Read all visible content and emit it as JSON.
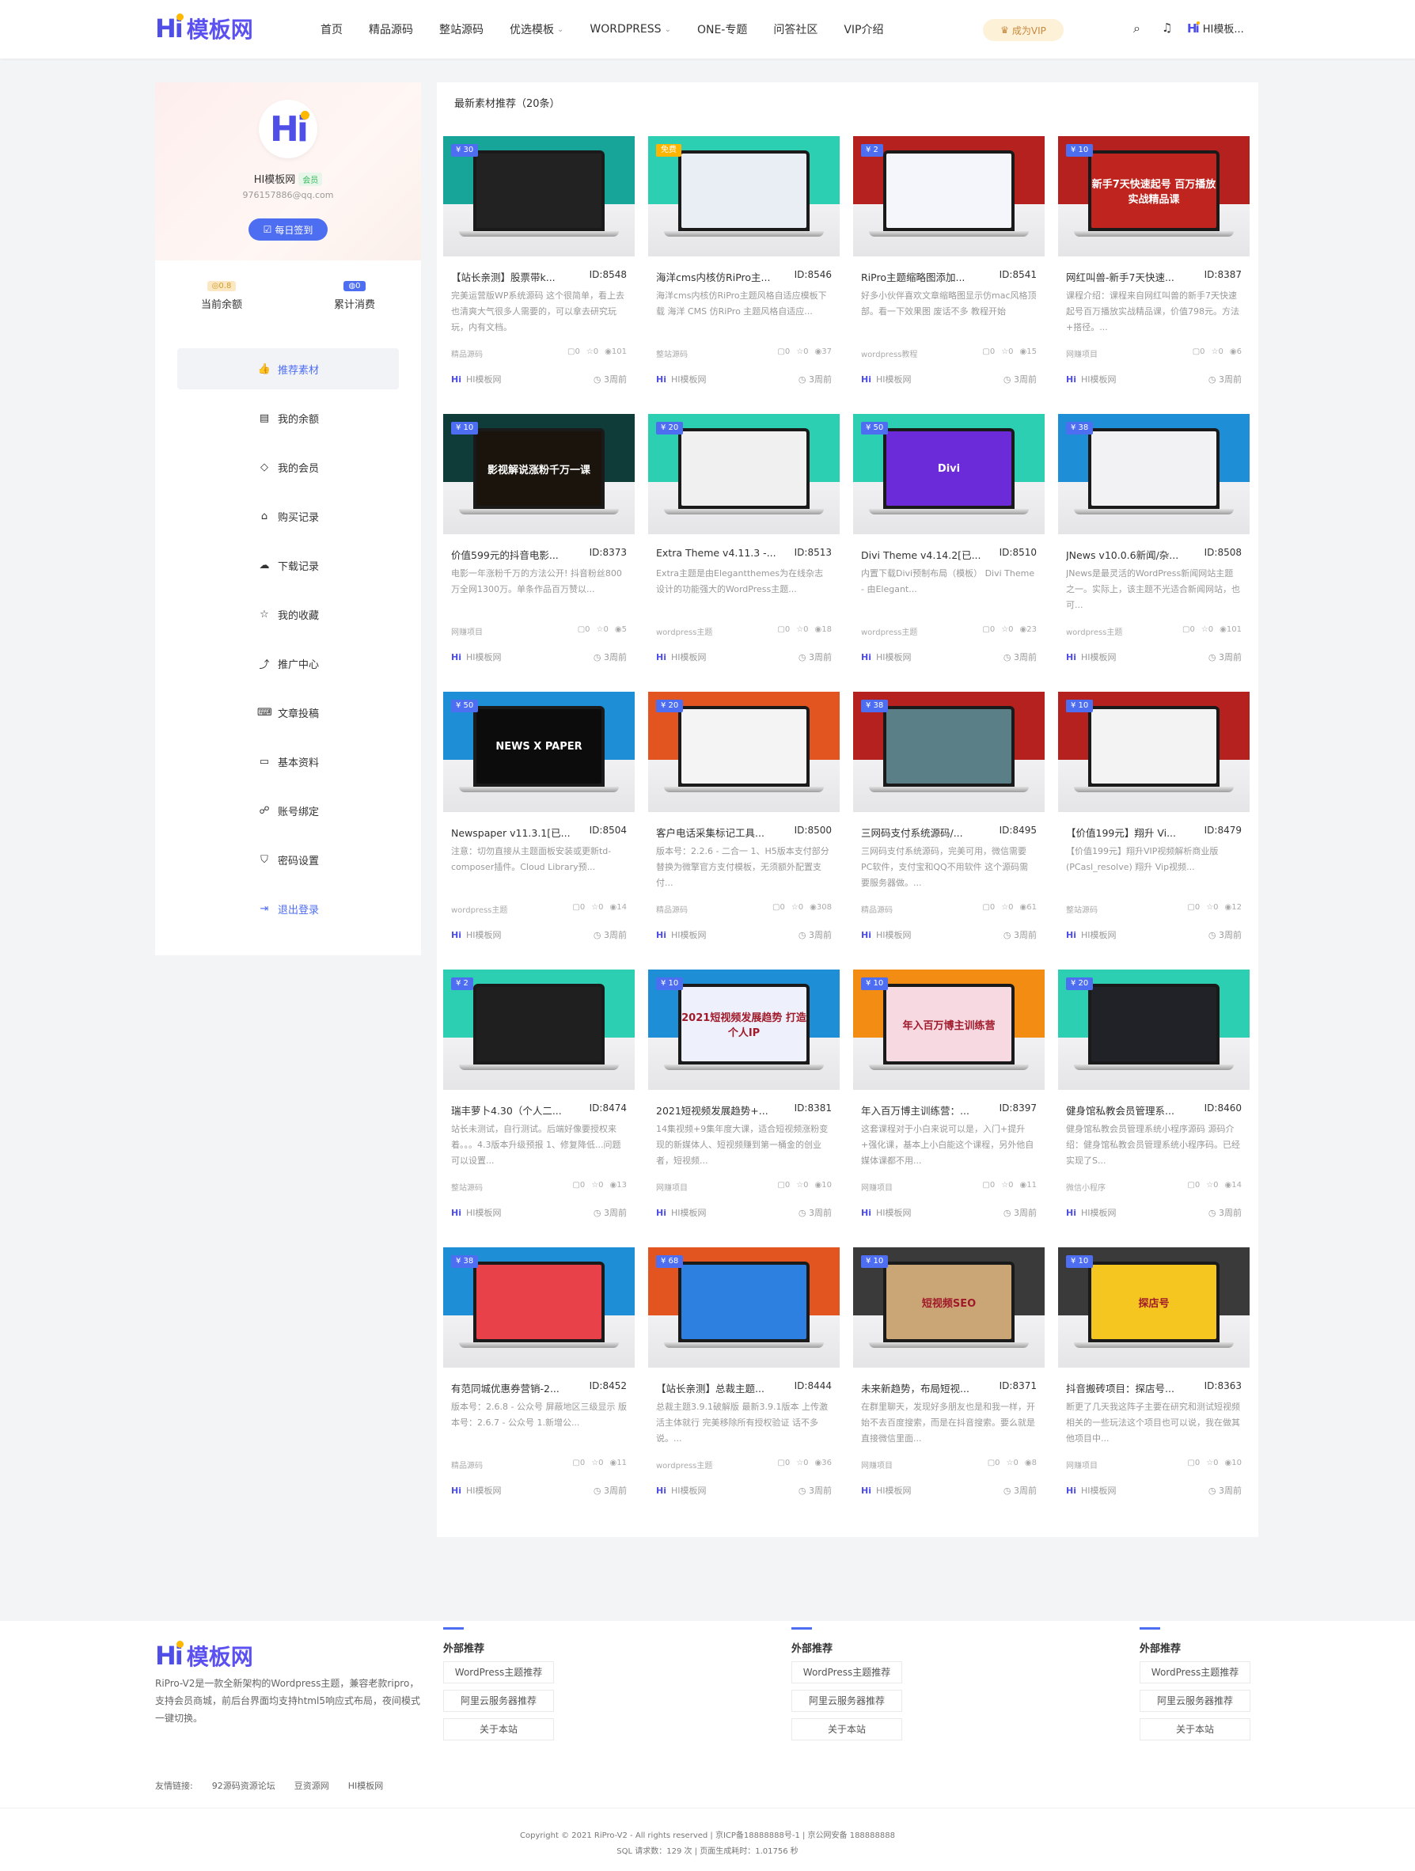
{
  "brand": {
    "hi": "Hi",
    "name": "模板网"
  },
  "nav": [
    {
      "label": "首页",
      "caret": false
    },
    {
      "label": "精品源码",
      "caret": false
    },
    {
      "label": "整站源码",
      "caret": false
    },
    {
      "label": "优选模板",
      "caret": true
    },
    {
      "label": "WORDPRESS",
      "caret": true
    },
    {
      "label": "ONE-专题",
      "caret": false
    },
    {
      "label": "问答社区",
      "caret": false
    },
    {
      "label": "VIP介绍",
      "caret": false
    }
  ],
  "header": {
    "vip_label": "成为VIP",
    "user_label": "HI模板..."
  },
  "sidebar": {
    "username": "HI模板网",
    "member_tag": "会员",
    "email": "976157886@qq.com",
    "sign_label": "每日签到",
    "balance_badge": "0.8",
    "balance_label": "当前余额",
    "spent_badge": "0",
    "spent_label": "累计消费",
    "menu": [
      {
        "label": "推荐素材",
        "icon": "thumbs-up-icon",
        "glyph": "👍",
        "active": true
      },
      {
        "label": "我的余额",
        "icon": "wallet-icon",
        "glyph": "▤"
      },
      {
        "label": "我的会员",
        "icon": "diamond-icon",
        "glyph": "◇"
      },
      {
        "label": "购买记录",
        "icon": "basket-icon",
        "glyph": "⌂"
      },
      {
        "label": "下载记录",
        "icon": "cloud-download-icon",
        "glyph": "☁"
      },
      {
        "label": "我的收藏",
        "icon": "star-icon",
        "glyph": "☆"
      },
      {
        "label": "推广中心",
        "icon": "share-icon",
        "glyph": "⤴"
      },
      {
        "label": "文章投稿",
        "icon": "keyboard-icon",
        "glyph": "⌨"
      },
      {
        "label": "基本资料",
        "icon": "id-card-icon",
        "glyph": "▭"
      },
      {
        "label": "账号绑定",
        "icon": "users-icon",
        "glyph": "☍"
      },
      {
        "label": "密码设置",
        "icon": "shield-icon",
        "glyph": "⛉"
      },
      {
        "label": "退出登录",
        "icon": "logout-icon",
        "glyph": "⇥",
        "logout": true
      }
    ]
  },
  "main": {
    "title": "最新素材推荐（20条）"
  },
  "cards": [
    {
      "price": "¥ 30",
      "title": "【站长亲测】股票带k...",
      "id": "ID:8548",
      "desc": "完美运营版WP系统源码 这个很简单，看上去也清爽大气很多人需要的，可以拿去研究玩玩，内有文档。",
      "cat": "精品源码",
      "comments": "0",
      "likes": "0",
      "views": "101",
      "author": "HI模板网",
      "time": "3周前",
      "band": "#17a59a",
      "screen": "#222",
      "screen_text": ""
    },
    {
      "price": "免费",
      "hot": true,
      "title": "海洋cms内核仿RiPro主...",
      "id": "ID:8546",
      "desc": "海洋cms内核仿RiPro主题风格自适应模板下载 海洋 CMS 仿RiPro 主题风格自适应...",
      "cat": "整站源码",
      "comments": "0",
      "likes": "0",
      "views": "37",
      "author": "HI模板网",
      "time": "3周前",
      "band": "#2dcfb3",
      "screen": "#e9eef5",
      "screen_text": ""
    },
    {
      "price": "¥ 2",
      "title": "RiPro主题缩略图添加...",
      "id": "ID:8541",
      "desc": "好多小伙伴喜欢文章缩略图显示仿mac风格顶部。看一下效果图 废话不多 教程开始",
      "cat": "wordpress教程",
      "comments": "0",
      "likes": "0",
      "views": "15",
      "author": "HI模板网",
      "time": "3周前",
      "band": "#b5211f",
      "screen": "#f4f6fb",
      "screen_text": ""
    },
    {
      "price": "¥ 10",
      "title": "网红叫兽-新手7天快速...",
      "id": "ID:8387",
      "desc": "课程介绍：课程来自网红叫兽的新手7天快速起号百万播放实战精品课，价值798元。方法+搭径。...",
      "cat": "网赚项目",
      "comments": "0",
      "likes": "0",
      "views": "6",
      "author": "HI模板网",
      "time": "3周前",
      "band": "#b5211f",
      "screen": "#c0241e",
      "screen_text": "新手7天快速起号 百万播放实战精品课"
    },
    {
      "price": "¥ 10",
      "title": "价值599元的抖音电影...",
      "id": "ID:8373",
      "desc": "电影一年涨粉千万的方法公开! 抖音粉丝800万全网1300万。单条作品百万赞以...",
      "cat": "网赚项目",
      "comments": "0",
      "likes": "0",
      "views": "5",
      "author": "HI模板网",
      "time": "3周前",
      "band": "#0f3b38",
      "screen": "#1a140c",
      "screen_text": "影视解说涨粉千万一课"
    },
    {
      "price": "¥ 20",
      "title": "Extra Theme v4.11.3 -...",
      "id": "ID:8513",
      "desc": "Extra主题是由Elegantthemes为在线杂志设计的功能强大的WordPress主题...",
      "cat": "wordpress主题",
      "comments": "0",
      "likes": "0",
      "views": "18",
      "author": "HI模板网",
      "time": "3周前",
      "band": "#2dcfb3",
      "screen": "#f0f0f0",
      "screen_text": ""
    },
    {
      "price": "¥ 50",
      "title": "Divi Theme v4.14.2[已...",
      "id": "ID:8510",
      "desc": "内置下载Divi预制布局（模板） Divi Theme - 由Elegant...",
      "cat": "wordpress主题",
      "comments": "0",
      "likes": "0",
      "views": "23",
      "author": "HI模板网",
      "time": "3周前",
      "band": "#2dcfb3",
      "screen": "#6b2bd9",
      "screen_text": "Divi"
    },
    {
      "price": "¥ 38",
      "title": "JNews v10.0.6新闻/杂...",
      "id": "ID:8508",
      "desc": "JNews是最灵活的WordPress新闻网站主题之一。实际上，该主题不光适合新闻网站，也可...",
      "cat": "wordpress主题",
      "comments": "0",
      "likes": "0",
      "views": "101",
      "author": "HI模板网",
      "time": "3周前",
      "band": "#1e8fd6",
      "screen": "#f2f2f4",
      "screen_text": ""
    },
    {
      "price": "¥ 50",
      "title": "Newspaper v11.3.1[已...",
      "id": "ID:8504",
      "desc": "注意：切勿直接从主题面板安装或更新td-composer插件。Cloud Library预...",
      "cat": "wordpress主题",
      "comments": "0",
      "likes": "0",
      "views": "14",
      "author": "HI模板网",
      "time": "3周前",
      "band": "#1e8fd6",
      "screen": "#0c0c0c",
      "screen_text": "NEWS X PAPER"
    },
    {
      "price": "¥ 20",
      "title": "客户电话采集标记工具...",
      "id": "ID:8500",
      "desc": "版本号：2.2.6 - 二合一 1、H5版本支付部分替换为微擎官方支付模板，无须额外配置支付...",
      "cat": "精品源码",
      "comments": "0",
      "likes": "0",
      "views": "308",
      "author": "HI模板网",
      "time": "3周前",
      "band": "#e25420",
      "screen": "#f4f4f4",
      "screen_text": ""
    },
    {
      "price": "¥ 38",
      "title": "三网码支付系统源码/...",
      "id": "ID:8495",
      "desc": "三网码支付系统源码，完美可用，微信需要PC软件，支付宝和QQ不用软件 这个源码需要服务器做。...",
      "cat": "精品源码",
      "comments": "0",
      "likes": "0",
      "views": "61",
      "author": "HI模板网",
      "time": "3周前",
      "band": "#b5211f",
      "screen": "#5b7f86",
      "screen_text": ""
    },
    {
      "price": "¥ 10",
      "title": "【价值199元】翔升 Vi...",
      "id": "ID:8479",
      "desc": "【价值199元】翔升VIP视频解析商业版(PCasl_resolve) 翔升 Vip视频...",
      "cat": "整站源码",
      "comments": "0",
      "likes": "0",
      "views": "12",
      "author": "HI模板网",
      "time": "3周前",
      "band": "#b5211f",
      "screen": "#f3f3f3",
      "screen_text": ""
    },
    {
      "price": "¥ 2",
      "title": "瑞丰萝卜4.30（个人二...",
      "id": "ID:8474",
      "desc": "站长未测试，自行测试。后端好像要授权来着。。。4.3版本升级预报 1、修复降低...问题可以设置...",
      "cat": "整站源码",
      "comments": "0",
      "likes": "0",
      "views": "13",
      "author": "HI模板网",
      "time": "3周前",
      "band": "#2dcfb3",
      "screen": "#1f1f1f",
      "screen_text": ""
    },
    {
      "price": "¥ 10",
      "title": "2021短视频发展趋势+...",
      "id": "ID:8381",
      "desc": "14集视频+9集年度大课，适合短视频涨粉变现的新媒体人、短视频赚到第一桶金的创业者，短视频...",
      "cat": "网赚项目",
      "comments": "0",
      "likes": "0",
      "views": "10",
      "author": "HI模板网",
      "time": "3周前",
      "band": "#1e8fd6",
      "screen": "#eef0fb",
      "screen_text": "2021短视频发展趋势 打造个人IP"
    },
    {
      "price": "¥ 10",
      "title": "年入百万博主训练营：...",
      "id": "ID:8397",
      "desc": "这套课程对于小白来说可以是，入门+提升+强化课，基本上小白能这个课程，另外他自媒体课都不用...",
      "cat": "网赚项目",
      "comments": "0",
      "likes": "0",
      "views": "11",
      "author": "HI模板网",
      "time": "3周前",
      "band": "#f28c12",
      "screen": "#f7d9e2",
      "screen_text": "年入百万博主训练营"
    },
    {
      "price": "¥ 20",
      "title": "健身馆私教会员管理系...",
      "id": "ID:8460",
      "desc": "健身馆私教会员管理系统小程序源码 源码介绍：健身馆私教会员管理系统小程序码。已经实现了S...",
      "cat": "微信小程序",
      "comments": "0",
      "likes": "0",
      "views": "14",
      "author": "HI模板网",
      "time": "3周前",
      "band": "#2dcfb3",
      "screen": "#202227",
      "screen_text": ""
    },
    {
      "price": "¥ 38",
      "title": "有范同城优惠券营销-2...",
      "id": "ID:8452",
      "desc": "版本号：2.6.8 - 公众号 屏蔽地区三级显示 版本号：2.6.7 - 公众号 1.新增公...",
      "cat": "精品源码",
      "comments": "0",
      "likes": "0",
      "views": "11",
      "author": "HI模板网",
      "time": "3周前",
      "band": "#1e8fd6",
      "screen": "#e8414a",
      "screen_text": ""
    },
    {
      "price": "¥ 68",
      "title": "【站长亲测】总裁主题...",
      "id": "ID:8444",
      "desc": "总裁主题3.9.1破解版 最新3.9.1版本 上传激活主体就行 完美移除所有授权验证 话不多说。...",
      "cat": "wordpress主题",
      "comments": "0",
      "likes": "0",
      "views": "36",
      "author": "HI模板网",
      "time": "3周前",
      "band": "#e25420",
      "screen": "#2d7fe0",
      "screen_text": ""
    },
    {
      "price": "¥ 10",
      "title": "未来新趋势，布局短视...",
      "id": "ID:8371",
      "desc": "在群里聊天，发现好多朋友也是和我一样，开始不去百度搜索，而是在抖音搜索。要么就是直接微信里面...",
      "cat": "网赚项目",
      "comments": "0",
      "likes": "0",
      "views": "8",
      "author": "HI模板网",
      "time": "3周前",
      "band": "#3a3a3a",
      "screen": "#caa576",
      "screen_text": "短视频SEO"
    },
    {
      "price": "¥ 10",
      "title": "抖音搬砖项目：探店号...",
      "id": "ID:8363",
      "desc": "断更了几天我这阵子主要在研究和测试短视频相关的一些玩法这个项目也可以说，我在做其他项目中...",
      "cat": "网赚项目",
      "comments": "0",
      "likes": "0",
      "views": "10",
      "author": "HI模板网",
      "time": "3周前",
      "band": "#3a3a3a",
      "screen": "#f6c620",
      "screen_text": "探店号"
    }
  ],
  "footer": {
    "desc": "RiPro-V2是一款全新架构的Wordpress主题，兼容老款ripro，支持会员商城，前后台界面均支持html5响应式布局，夜间模式一键切换。",
    "columns": [
      {
        "title": "外部推荐",
        "links": [
          "WordPress主题推荐",
          "阿里云服务器推荐",
          "关于本站"
        ]
      },
      {
        "title": "外部推荐",
        "links": [
          "WordPress主题推荐",
          "阿里云服务器推荐",
          "关于本站"
        ]
      },
      {
        "title": "外部推荐",
        "links": [
          "WordPress主题推荐",
          "阿里云服务器推荐",
          "关于本站"
        ]
      }
    ],
    "friend_label": "友情链接:",
    "friends": [
      "92源码资源论坛",
      "豆资源网",
      "HI模板网"
    ],
    "copyright": "Copyright © 2021  RiPro-V2  - All rights reserved  |  京ICP备18888888号-1  |  京公网安备 188888888",
    "sql": "SQL 请求数：129 次 | 页面生成耗时：1.01756 秒"
  }
}
